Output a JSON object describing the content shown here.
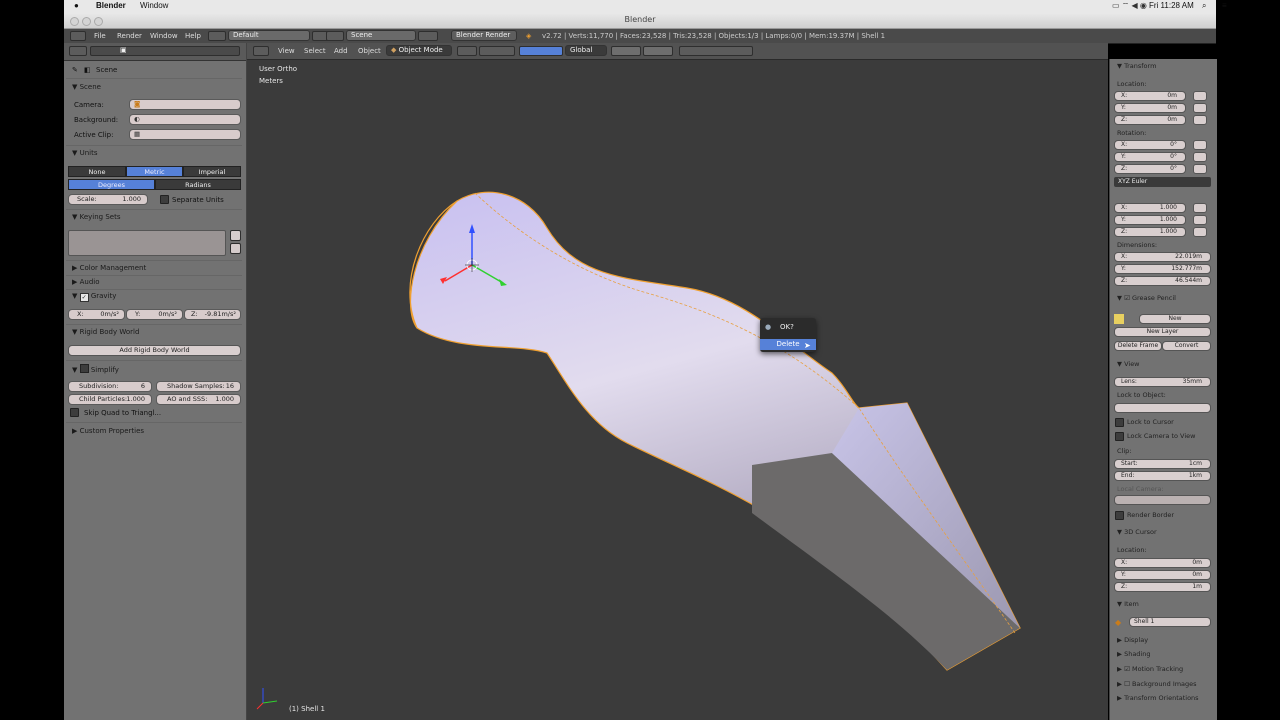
{
  "mac_menu": {
    "app": "Blender",
    "window": "Window",
    "clock": "Fri 11:28 AM"
  },
  "window_title": "Blender",
  "info_header": {
    "menus": [
      "File",
      "Render",
      "Window",
      "Help"
    ],
    "layout": "Default",
    "scene": "Scene",
    "engine": "Blender Render",
    "stats": "v2.72 | Verts:11,770 | Faces:23,528 | Tris:23,528 | Objects:1/3 | Lamps:0/0 | Mem:19.37M | Shell 1"
  },
  "properties": {
    "breadcrumb": "Scene",
    "scene_panel": {
      "title": "Scene",
      "camera": "Camera:",
      "background": "Background:",
      "active_clip": "Active Clip:"
    },
    "units": {
      "title": "Units",
      "systems": [
        "None",
        "Metric",
        "Imperial"
      ],
      "rotation": [
        "Degrees",
        "Radians"
      ],
      "scale_label": "Scale:",
      "scale_value": "1.000",
      "separate_units": "Separate Units"
    },
    "keying_sets": "Keying Sets",
    "color_management": "Color Management",
    "audio": "Audio",
    "gravity": {
      "title": "Gravity",
      "x": "X:",
      "x_val": "0m/s²",
      "y": "Y:",
      "y_val": "0m/s²",
      "z": "Z:",
      "z_val": "-9.81m/s²"
    },
    "rigid_body_world": {
      "title": "Rigid Body World",
      "button": "Add Rigid Body World"
    },
    "simplify": {
      "title": "Simplify",
      "subdivision": "Subdivision:",
      "subdivision_val": "6",
      "shadow_samples": "Shadow Samples:",
      "shadow_samples_val": "16",
      "child_particles": "Child Particles:",
      "child_particles_val": "1.000",
      "ao_sss": "AO and SSS:",
      "ao_sss_val": "1.000",
      "skip_quad": "Skip Quad to Triangl..."
    },
    "custom_properties": "Custom Properties"
  },
  "viewport": {
    "menus": [
      "View",
      "Select",
      "Add",
      "Object"
    ],
    "mode": "Object Mode",
    "orientation": "Global",
    "view_name": "User Ortho",
    "units": "Meters",
    "object_label": "(1) Shell 1"
  },
  "popup": {
    "question": "OK?",
    "action": "Delete"
  },
  "nview": {
    "transform": "Transform",
    "location": "Location:",
    "loc": [
      {
        "k": "X:",
        "v": "0m"
      },
      {
        "k": "Y:",
        "v": "0m"
      },
      {
        "k": "Z:",
        "v": "0m"
      }
    ],
    "rotation": "Rotation:",
    "rot": [
      {
        "k": "X:",
        "v": "0°"
      },
      {
        "k": "Y:",
        "v": "0°"
      },
      {
        "k": "Z:",
        "v": "0°"
      }
    ],
    "rot_mode": "XYZ Euler",
    "scale_vals": [
      {
        "k": "X:",
        "v": "1.000"
      },
      {
        "k": "Y:",
        "v": "1.000"
      },
      {
        "k": "Z:",
        "v": "1.000"
      }
    ],
    "dimensions": "Dimensions:",
    "dims": [
      {
        "k": "X:",
        "v": "22.019m"
      },
      {
        "k": "Y:",
        "v": "152.777m"
      },
      {
        "k": "Z:",
        "v": "46.544m"
      }
    ],
    "grease_pencil": "Grease Pencil",
    "gp_new": "New",
    "gp_new_layer": "New Layer",
    "gp_delete_frame": "Delete Frame",
    "gp_convert": "Convert",
    "view": "View",
    "lens_label": "Lens:",
    "lens_val": "35mm",
    "lock_to_object": "Lock to Object:",
    "lock_to_cursor": "Lock to Cursor",
    "lock_camera": "Lock Camera to View",
    "clip": "Clip:",
    "clip_start_label": "Start:",
    "clip_start": "1cm",
    "clip_end_label": "End:",
    "clip_end": "1km",
    "local_camera": "Local Camera:",
    "render_border": "Render Border",
    "cursor": "3D Cursor",
    "cursor_loc": "Location:",
    "cur": [
      {
        "k": "X:",
        "v": "0m"
      },
      {
        "k": "Y:",
        "v": "0m"
      },
      {
        "k": "Z:",
        "v": "1m"
      }
    ],
    "item": "Item",
    "item_name": "Shell 1",
    "display": "Display",
    "shading": "Shading",
    "motion_tracking": "Motion Tracking",
    "background_images": "Background Images",
    "transform_orientations": "Transform Orientations"
  },
  "colors": {
    "accent_blue": "#5681d8",
    "selection_orange": "#f0a030",
    "viewport_bg": "#3b3b3b"
  }
}
